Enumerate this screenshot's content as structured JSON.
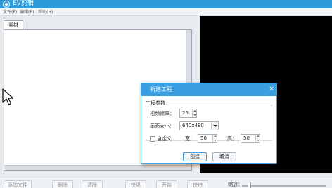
{
  "window": {
    "title": "EV剪辑"
  },
  "menu": {
    "items": [
      "文件(F)",
      "编辑(E)",
      "帮助(H)"
    ]
  },
  "left_panel": {
    "tab_label": "素材"
  },
  "bottom_toolbar": {
    "buttons": [
      "添加文件",
      "删除",
      "清除",
      "快退",
      "开始",
      "快进"
    ],
    "zoom_label": "缩放："
  },
  "dialog": {
    "title": "新建工程",
    "close_glyph": "×",
    "group_label": "工程参数",
    "fps_label": "视频帧率：",
    "fps_value": "25",
    "size_label": "画面大小：",
    "size_value": "640x480",
    "custom_label": "自定义",
    "width_label": "宽：",
    "width_value": "50",
    "height_label": "高：",
    "height_value": "50",
    "create_button": "创建",
    "cancel_button": "取消"
  },
  "colors": {
    "accent": "#3a9ee0",
    "titlebar": "#2e9ad8",
    "preview": "#000000"
  }
}
